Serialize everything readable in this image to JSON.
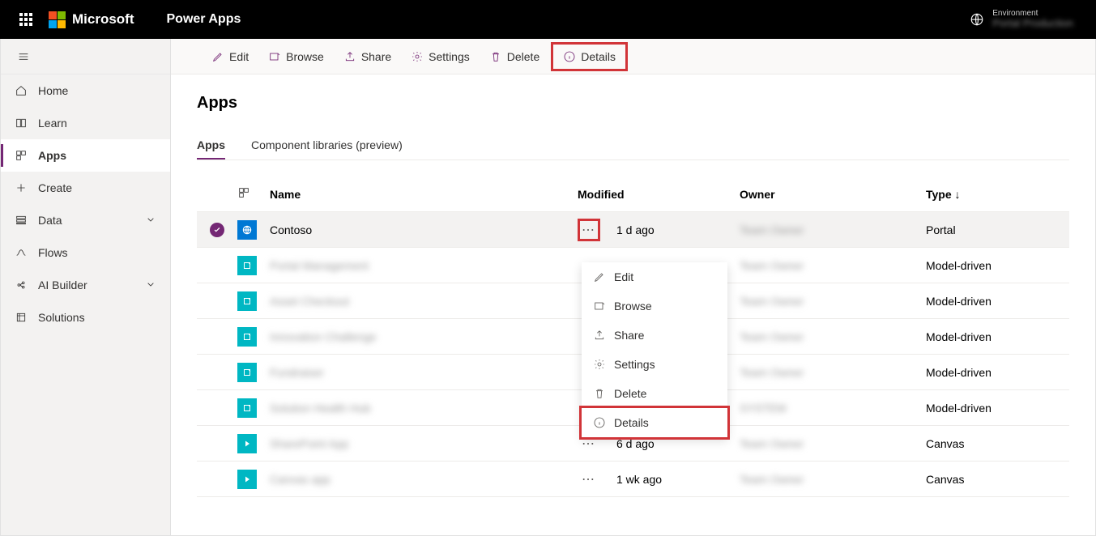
{
  "header": {
    "brand": "Microsoft",
    "product": "Power Apps",
    "env_label": "Environment",
    "env_name": "Portal Production"
  },
  "sidebar": {
    "items": [
      {
        "label": "Home"
      },
      {
        "label": "Learn"
      },
      {
        "label": "Apps"
      },
      {
        "label": "Create"
      },
      {
        "label": "Data"
      },
      {
        "label": "Flows"
      },
      {
        "label": "AI Builder"
      },
      {
        "label": "Solutions"
      }
    ]
  },
  "commands": {
    "edit": "Edit",
    "browse": "Browse",
    "share": "Share",
    "settings": "Settings",
    "delete": "Delete",
    "details": "Details"
  },
  "page": {
    "title": "Apps",
    "tabs": {
      "apps": "Apps",
      "component_libs": "Component libraries (preview)"
    }
  },
  "table": {
    "headers": {
      "name": "Name",
      "modified": "Modified",
      "owner": "Owner",
      "type": "Type ↓"
    },
    "rows": [
      {
        "name": "Contoso",
        "modified": "1 d ago",
        "owner": "Team Owner",
        "type": "Portal",
        "icon": "portal",
        "selected": true,
        "blurred": false
      },
      {
        "name": "Portal Management",
        "modified": "",
        "owner": "Team Owner",
        "type": "Model-driven",
        "icon": "model",
        "blurred": true
      },
      {
        "name": "Asset Checkout",
        "modified": "",
        "owner": "Team Owner",
        "type": "Model-driven",
        "icon": "model",
        "blurred": true
      },
      {
        "name": "Innovation Challenge",
        "modified": "",
        "owner": "Team Owner",
        "type": "Model-driven",
        "icon": "model",
        "blurred": true
      },
      {
        "name": "Fundraiser",
        "modified": "",
        "owner": "Team Owner",
        "type": "Model-driven",
        "icon": "model",
        "blurred": true
      },
      {
        "name": "Solution Health Hub",
        "modified": "",
        "owner": "SYSTEM",
        "type": "Model-driven",
        "icon": "model",
        "blurred": true
      },
      {
        "name": "SharePoint App",
        "modified": "6 d ago",
        "owner": "Team Owner",
        "type": "Canvas",
        "icon": "canvas",
        "blurred": true
      },
      {
        "name": "Canvas app",
        "modified": "1 wk ago",
        "owner": "Team Owner",
        "type": "Canvas",
        "icon": "canvas",
        "blurred": true
      }
    ]
  },
  "context_menu": {
    "edit": "Edit",
    "browse": "Browse",
    "share": "Share",
    "settings": "Settings",
    "delete": "Delete",
    "details": "Details"
  }
}
